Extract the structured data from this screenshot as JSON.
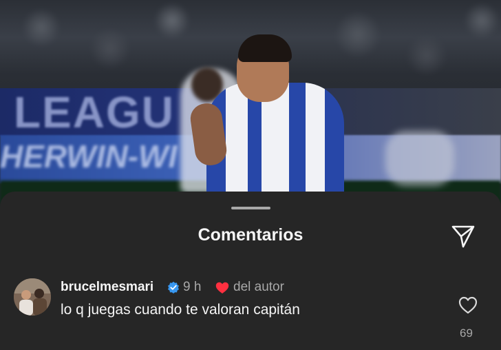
{
  "background": {
    "banner_text": "LEAGU",
    "banner2_text": "HERWIN-WI"
  },
  "sheet": {
    "title": "Comentarios"
  },
  "comment": {
    "username": "brucelmesmari",
    "time": "9 h",
    "author_label": "del autor",
    "text": "lo q juegas cuando te valoran capitán",
    "like_count": "69",
    "verified": true,
    "liked_by_author": true
  },
  "colors": {
    "sheet_bg": "#262626",
    "verified_blue": "#3897f0",
    "heart_red": "#ff3040",
    "secondary_text": "#a8a8a8"
  },
  "icons": [
    "send-icon",
    "verified-icon",
    "heart-liked-icon",
    "like-heart-icon"
  ]
}
